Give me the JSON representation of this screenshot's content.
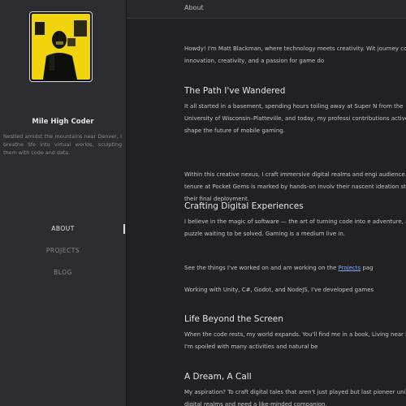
{
  "sidebar": {
    "title": "Mile High Coder",
    "description": "Nestled amidst the mountains near Denver, I breathe life into virtual worlds, sculpting them with code and data.",
    "nav": [
      {
        "label": "ABOUT",
        "active": true
      },
      {
        "label": "PROJECTS",
        "active": false
      },
      {
        "label": "BLOG",
        "active": false
      }
    ]
  },
  "topbar": {
    "title": "About"
  },
  "content": {
    "intro": "Howdy! I'm Matt Blackman, where technology meets creativity. Wit journey combines innovation, creativity, and a passion for game do",
    "sections": [
      {
        "heading": "The Path I've Wandered",
        "paragraphs": [
          "It all started in a basement, spending hours toiling away at Super N from the University of Wisconsin–Platteville, and today, my professi contributions actively shape the future of mobile gaming.",
          "Within this creative nexus, I craft immersive digital realms and engi audience. My tenure at Pocket Gems is marked by hands-on involv their nascent ideation stages to their final deployment."
        ]
      },
      {
        "heading": "Crafting Digital Experiences",
        "paragraphs": [
          "I believe in the magic of software — the art of turning code into e adventure, a new puzzle waiting to be solved. Gaming is a medium live in."
        ],
        "projects_line": {
          "before": "See the things I've worked on and am working on the ",
          "link": "Projects",
          "after": " pag"
        },
        "tools_line": "Working with Unity, C#, Godot, and NodeJS, I've developed games"
      },
      {
        "heading": "Life Beyond the Screen",
        "paragraphs": [
          "When the code rests, my world expands. You'll find me in a book, Living near Denver, I'm spoiled with many activities and natural be"
        ]
      },
      {
        "heading": "A Dream, A Call",
        "paragraphs": [
          "My aspiration? To craft digital tales that aren't just played but last pioneer unique digital realms and need a like-minded companion,"
        ]
      }
    ]
  },
  "colors": {
    "accent_link": "#7fa8ff",
    "avatar_yellow": "#f2d40c"
  }
}
